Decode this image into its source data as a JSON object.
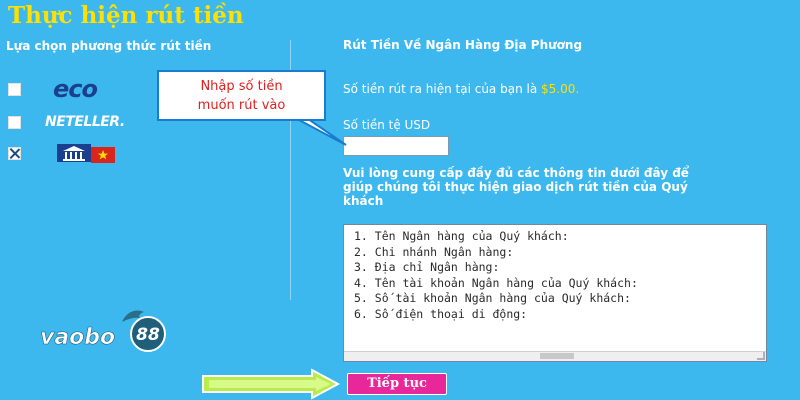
{
  "page": {
    "title": "Thực hiện rút tiền"
  },
  "methods": {
    "heading": "Lựa chọn phương thức rút tiền",
    "items": [
      {
        "name": "eco",
        "checked": false
      },
      {
        "name": "NETELLER.",
        "checked": false
      },
      {
        "name": "bank-transfer",
        "checked": true
      }
    ]
  },
  "withdraw": {
    "title": "Rút Tiền Về Ngân Hàng Địa Phương",
    "balance_text": "Số tiền rút ra hiện tại của bạn là ",
    "balance_amount": "$5.00.",
    "currency_label": "Số tiền tệ USD",
    "amount_value": "",
    "instructions": "Vui lòng cung cấp đầy đủ các thông tin dưới đây để giúp chúng tôi thực hiện giao dịch rút tiền của Quý khách",
    "details_text": "1. Tên Ngân hàng của Quý khách:\n2. Chi nhánh Ngân hàng:\n3. Địa chỉ Ngân hàng:\n4. Tên tài khoản Ngân hàng của Quý khách:\n5. Số tài khoản Ngân hàng của Quý khách:\n6. Số điện thoại di động:",
    "continue_label": "Tiếp tục"
  },
  "callout": {
    "line1": "Nhập số tiền",
    "line2": "muốn rút vào"
  },
  "brand": {
    "name": "vaobo",
    "number": "88"
  },
  "colors": {
    "background": "#3cb8ee",
    "title": "#ffe000",
    "accent_button": "#e8289a",
    "callout_text": "#e02020",
    "arrow": "#c8f060"
  }
}
